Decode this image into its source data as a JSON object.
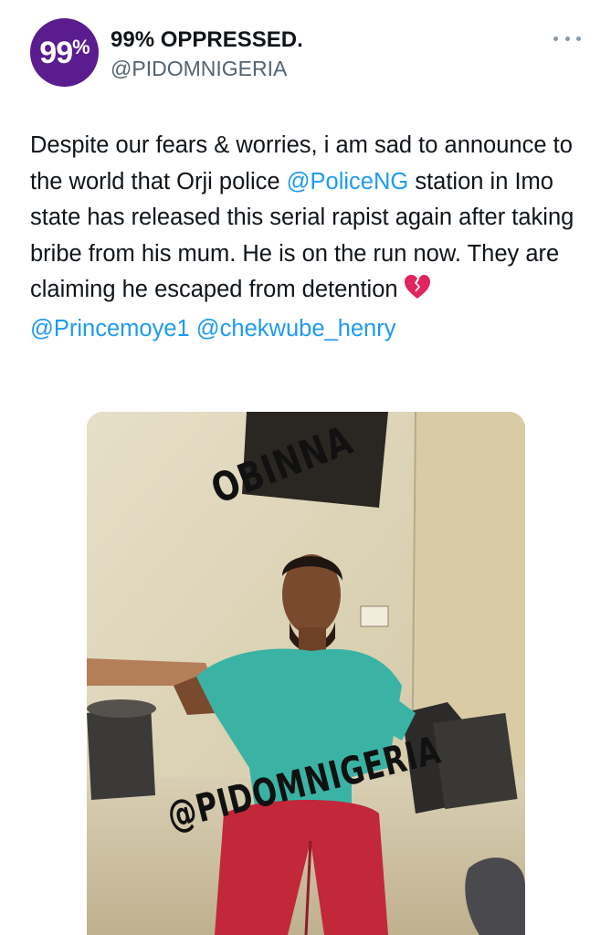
{
  "author": {
    "avatar_text": "99",
    "avatar_pct": "%",
    "display_name": "99% OPPRESSED.",
    "handle": "@PIDOMNIGERIA"
  },
  "more_icon": "more-horizontal-icon",
  "tweet": {
    "text_1": "Despite our fears & worries, i am sad to announce to the world that Orji police",
    "mention_1": "@PoliceNG",
    "text_2": " station in Imo state has released this serial rapist again after taking bribe from his mum. He is on the run now. They are claiming he escaped from detention",
    "emoji": "broken-heart-icon",
    "mention_2": "@Princemoye1",
    "mention_3": "@chekwube_henry"
  },
  "media": {
    "watermark_name": "OBINNA",
    "watermark_handle": "@PIDOMNIGERIA"
  },
  "colors": {
    "link": "#1d9bf0",
    "handle_grey": "#536471",
    "avatar_purple": "#5a1c8e"
  }
}
